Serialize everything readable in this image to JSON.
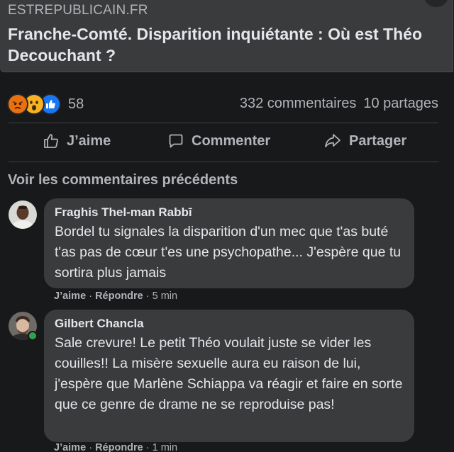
{
  "link_preview": {
    "domain": "ESTREPUBLICAIN.FR",
    "title": "Franche-Comté. Disparition inquiétante : Où est Théo Decouchant ?"
  },
  "reactions": {
    "icons": [
      "angry-icon",
      "wow-icon",
      "like-icon"
    ],
    "count": "58",
    "comments": "332 commentaires",
    "shares": "10 partages"
  },
  "actions": {
    "like": "J’aime",
    "comment": "Commenter",
    "share": "Partager"
  },
  "view_previous": "Voir les commentaires précédents",
  "comments": [
    {
      "author": "Fraghis Thel-man Rabbī",
      "text": "Bordel tu signales la disparition d'un mec que t'as buté t'as pas de cœur t'es une psychopathe... J'espère que tu sortira plus jamais",
      "like": "J’aime",
      "reply": "Répondre",
      "time": "5 min"
    },
    {
      "author": "Gilbert Chancla",
      "text": "Sale crevure! Le petit Théo voulait juste se vider les couilles!! La misère sexuelle aura eu raison de lui, j'espère que Marlène Schiappa va réagir et faire en sorte que ce genre de drame ne se reproduise pas!",
      "like": "J’aime",
      "reply": "Répondre",
      "time": "1 min"
    }
  ],
  "sep": "·",
  "colors": {
    "background": "#18191a",
    "card": "#3a3b3c",
    "text": "#e4e6eb",
    "secondary_text": "#b0b3b8",
    "like_blue": "#1877f2",
    "angry_orange": "#e9710f",
    "wow_yellow": "#f7b125",
    "online_green": "#31a24c"
  }
}
